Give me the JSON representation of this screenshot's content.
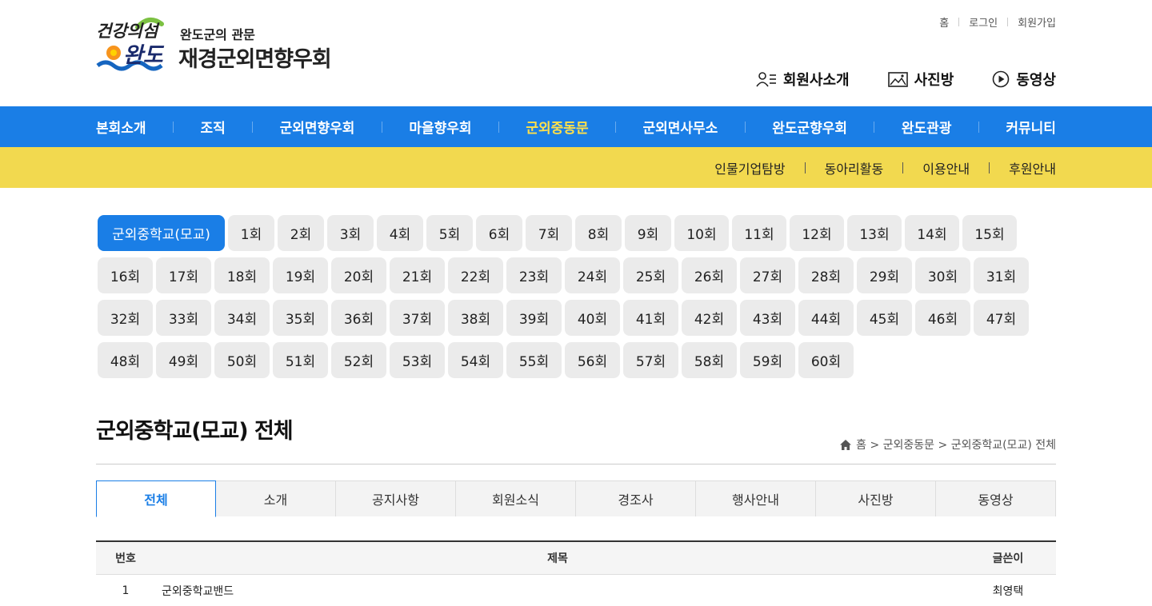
{
  "logo": {
    "mark_text_top": "건강의섬",
    "mark_text_bottom": "완도",
    "sub": "완도군의 관문",
    "main": "재경군외면향우회"
  },
  "util_links": [
    "홈",
    "로그인",
    "회원가입"
  ],
  "quick_links": [
    {
      "label": "회원사소개",
      "icon": "members-icon"
    },
    {
      "label": "사진방",
      "icon": "photo-icon"
    },
    {
      "label": "동영상",
      "icon": "play-icon"
    }
  ],
  "gnb": {
    "items": [
      "본회소개",
      "조직",
      "군외면향우회",
      "마을향우회",
      "군외중동문",
      "군외면사무소",
      "완도군향우회",
      "완도관광",
      "커뮤니티"
    ],
    "active_index": 4,
    "color": "#1a7ee6",
    "active_color": "#ffe04a"
  },
  "subnav": {
    "items": [
      "인물기업탐방",
      "동아리활동",
      "이용안내",
      "후원안내"
    ],
    "color": "#f2d94f"
  },
  "classes": {
    "items": [
      "군외중학교(모교)",
      "1회",
      "2회",
      "3회",
      "4회",
      "5회",
      "6회",
      "7회",
      "8회",
      "9회",
      "10회",
      "11회",
      "12회",
      "13회",
      "14회",
      "15회",
      "16회",
      "17회",
      "18회",
      "19회",
      "20회",
      "21회",
      "22회",
      "23회",
      "24회",
      "25회",
      "26회",
      "27회",
      "28회",
      "29회",
      "30회",
      "31회",
      "32회",
      "33회",
      "34회",
      "35회",
      "36회",
      "37회",
      "38회",
      "39회",
      "40회",
      "41회",
      "42회",
      "43회",
      "44회",
      "45회",
      "46회",
      "47회",
      "48회",
      "49회",
      "50회",
      "51회",
      "52회",
      "53회",
      "54회",
      "55회",
      "56회",
      "57회",
      "58회",
      "59회",
      "60회"
    ],
    "active_index": 0
  },
  "page": {
    "title": "군외중학교(모교) 전체",
    "breadcrumb": "홈 > 군외중동문 > 군외중학교(모교) 전체"
  },
  "tabs": {
    "items": [
      "전체",
      "소개",
      "공지사항",
      "회원소식",
      "경조사",
      "행사안내",
      "사진방",
      "동영상"
    ],
    "active_index": 0
  },
  "board": {
    "headers": {
      "no": "번호",
      "title": "제목",
      "writer": "글쓴이"
    },
    "rows": [
      {
        "no": "1",
        "title": "군외중학교밴드",
        "writer": "최영택"
      }
    ]
  }
}
